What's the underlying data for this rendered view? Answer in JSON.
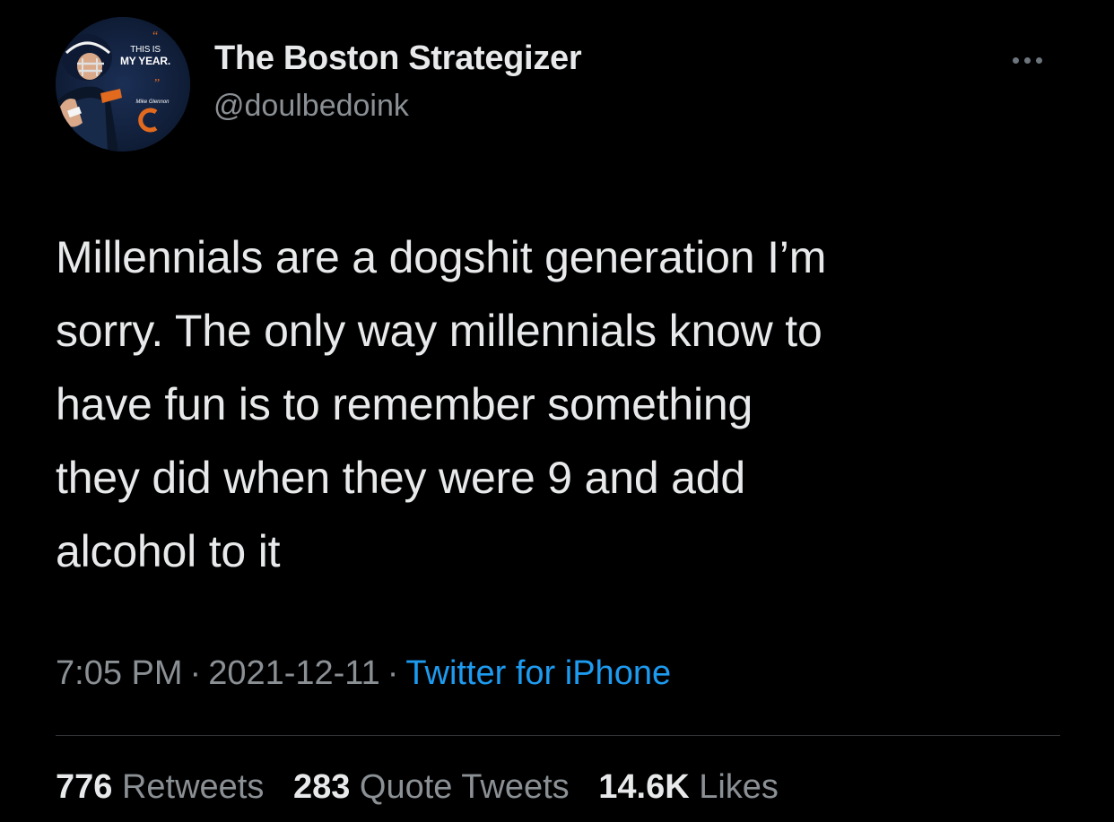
{
  "author": {
    "display_name": "The Boston Strategizer",
    "handle": "@doulbedoink",
    "avatar": {
      "caption_top": "THIS IS",
      "caption_main": "MY YEAR.",
      "credit": "Mike Glennon",
      "logo_letter": "C"
    }
  },
  "tweet": {
    "text": "Millennials are a dogshit generation I’m\nsorry. The only way millennials know to\nhave fun is to remember something\nthey did when they were 9 and add\nalcohol to it"
  },
  "meta": {
    "time": "7:05 PM",
    "separator": "·",
    "date": "2021-12-11",
    "source": "Twitter for iPhone"
  },
  "stats": {
    "retweets_count": "776",
    "retweets_label": "Retweets",
    "quotes_count": "283",
    "quotes_label": "Quote Tweets",
    "likes_count": "14.6K",
    "likes_label": "Likes"
  },
  "colors": {
    "background": "#000000",
    "text_primary": "#e7e9ea",
    "text_secondary": "#8b9095",
    "link": "#1d9bf0",
    "divider": "#2f3336"
  },
  "icons": {
    "more": "more-horizontal-icon"
  }
}
